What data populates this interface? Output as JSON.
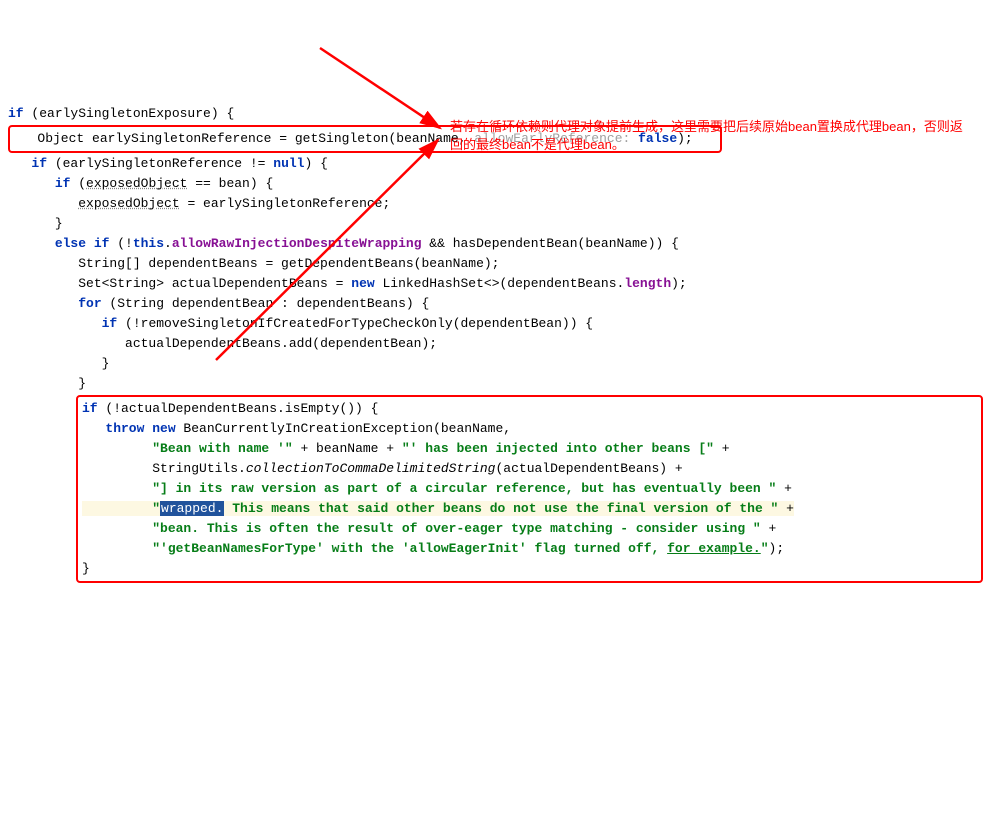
{
  "line1": {
    "kw": "if",
    "open": " (earlySingletonExposure) {"
  },
  "line2": {
    "txt": "Object earlySingletonReference = getSingleton(beanName, ",
    "hint": "allowEarlyReference: ",
    "kw": "false",
    "end": ");"
  },
  "line3": {
    "kw": "if",
    "open": " (earlySingletonReference != ",
    "nul": "null",
    "end": ") {"
  },
  "line4": {
    "kw": "if",
    "open": " (",
    "v": "exposedObject",
    "mid": " == bean) {"
  },
  "line5": {
    "v": "exposedObject",
    "end": " = earlySingletonReference;"
  },
  "line6": "}",
  "line7": {
    "kw": "else if",
    "open": " (!",
    "th": "this",
    "dot": ".",
    "m": "allowRawInjectionDespiteWrapping",
    "end": " && hasDependentBean(beanName)) {"
  },
  "line8": "String[] dependentBeans = getDependentBeans(beanName);",
  "line9": {
    "a": "Set<String> actualDependentBeans = ",
    "kw": "new",
    "b": " LinkedHashSet<>(dependentBeans.",
    "len": "length",
    "c": ");"
  },
  "line10": {
    "kw": "for",
    "txt": " (String dependentBean : dependentBeans) {"
  },
  "line11": {
    "kw": "if",
    "txt": " (!removeSingletonIfCreatedForTypeCheckOnly(dependentBean)) {"
  },
  "line12": "actualDependentBeans.add(dependentBean);",
  "line13": "}",
  "line14": "}",
  "line15": {
    "kw": "if",
    "txt": " (!actualDependentBeans.isEmpty()) {"
  },
  "line16": {
    "kw": "throw new",
    "ex": " BeanCurrentlyInCreationException(beanName,"
  },
  "line17": {
    "s1": "\"Bean with name '\"",
    "p": " + beanName + ",
    "s2": "\"' has been injected into other beans [\"",
    "end": " +"
  },
  "line18": {
    "a": "StringUtils.",
    "m": "collectionToCommaDelimitedString",
    "b": "(actualDependentBeans) +"
  },
  "line19": {
    "s": "\"] in its raw version as part of a circular reference, but has eventually been \"",
    "end": " +"
  },
  "line20": {
    "s1": "\"",
    "hl": "wrapped.",
    "s2": " This means that said other beans do not use the final version of the \"",
    "end": " +"
  },
  "line21": {
    "s": "\"bean. This is often the result of over-eager type matching - consider using \"",
    "end": " +"
  },
  "line22": {
    "s": "\"'getBeanNamesForType' with the 'allowEagerInit' flag turned off, ",
    "u": "for example.",
    "s2": "\"",
    "end": ");"
  },
  "line23": "}",
  "annotation": "若存在循环依赖则代理对象提前生成，这里需要把后续原始bean置换成代理bean，否则返回的最终bean不是代理bean。"
}
